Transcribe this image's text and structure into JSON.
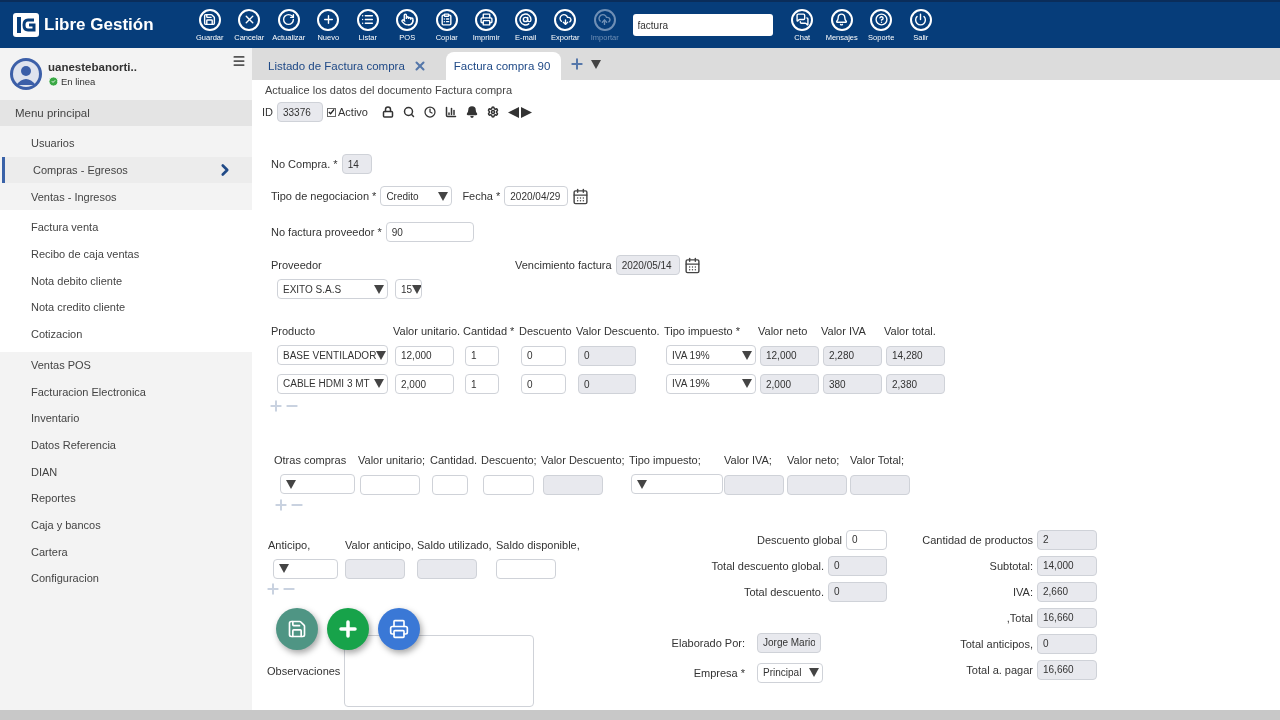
{
  "app": {
    "name": "Libre Gestión"
  },
  "toolbar": [
    {
      "label": "Guardar",
      "kind": "save",
      "disabled": false
    },
    {
      "label": "Cancelar",
      "kind": "cancel",
      "disabled": false
    },
    {
      "label": "Actualizar",
      "kind": "refresh",
      "disabled": false
    },
    {
      "label": "Nuevo",
      "kind": "new",
      "disabled": false
    },
    {
      "label": "Listar",
      "kind": "list",
      "disabled": false
    },
    {
      "label": "POS",
      "kind": "pos",
      "disabled": false
    },
    {
      "label": "Copiar",
      "kind": "copy",
      "disabled": false
    },
    {
      "label": "Imprimir",
      "kind": "print",
      "disabled": false
    },
    {
      "label": "E-mail",
      "kind": "email",
      "disabled": false
    },
    {
      "label": "Exportar",
      "kind": "export",
      "disabled": false
    },
    {
      "label": "Importar",
      "kind": "import",
      "disabled": true
    }
  ],
  "search": {
    "value": "factura"
  },
  "toolbar_right": [
    {
      "label": "Chat",
      "kind": "chat"
    },
    {
      "label": "Mensajes",
      "kind": "bell"
    },
    {
      "label": "Soporte",
      "kind": "help"
    },
    {
      "label": "Salir",
      "kind": "power"
    }
  ],
  "user": {
    "name": "uanestebanorti..",
    "status": "En linea"
  },
  "sidebar": {
    "header": "Menu principal",
    "items": [
      {
        "label": "Usuarios",
        "selected": false
      },
      {
        "label": "Compras - Egresos",
        "selected": true
      },
      {
        "label": "Ventas - Ingresos",
        "selected": false,
        "children": [
          {
            "label": "Factura venta",
            "selected": false
          },
          {
            "label": "Recibo de caja ventas",
            "selected": false
          },
          {
            "label": "Nota debito cliente",
            "selected": false
          },
          {
            "label": "Nota credito cliente",
            "selected": false
          },
          {
            "label": "Cotizacion",
            "selected": false
          }
        ]
      },
      {
        "label": "Ventas POS",
        "selected": false
      },
      {
        "label": "Facturacion Electronica",
        "selected": false
      },
      {
        "label": "Inventario",
        "selected": false
      },
      {
        "label": "Datos Referencia",
        "selected": false
      },
      {
        "label": "DIAN",
        "selected": false
      },
      {
        "label": "Reportes",
        "selected": false
      },
      {
        "label": "Caja y bancos",
        "selected": false
      },
      {
        "label": "Cartera",
        "selected": false
      },
      {
        "label": "Configuracion",
        "selected": false
      }
    ]
  },
  "tabs": [
    {
      "label": "Listado de Factura compra",
      "selected": false,
      "closable": true
    },
    {
      "label": "Factura compra 90",
      "selected": true,
      "closable": false
    }
  ],
  "form": {
    "subtitle": "Actualice los datos del documento Factura compra",
    "id": {
      "label": "ID",
      "value": "33376"
    },
    "active": {
      "label": "Activo",
      "checked": true
    },
    "no_compra": {
      "label": "No Compra. *",
      "value": "14"
    },
    "tipo_negociacion": {
      "label": "Tipo de negociacion *",
      "value": "Credito"
    },
    "fecha": {
      "label": "Fecha *",
      "value": "2020/04/29"
    },
    "no_factura_proveedor": {
      "label": "No factura proveedor *",
      "value": "90"
    },
    "proveedor": {
      "label": "Proveedor",
      "value": "EXITO S.A.S",
      "days": "15"
    },
    "vencimiento": {
      "label": "Vencimiento factura",
      "value": "2020/05/14"
    },
    "products": {
      "columns": [
        {
          "label": "Producto",
          "kind": "select"
        },
        {
          "label": "Valor unitario.",
          "kind": "input"
        },
        {
          "label": "Cantidad *",
          "kind": "input"
        },
        {
          "label": "Descuento",
          "kind": "input"
        },
        {
          "label": "Valor Descuento.",
          "kind": "readonly"
        },
        {
          "label": "Tipo impuesto *",
          "kind": "select"
        },
        {
          "label": "Valor neto",
          "kind": "readonly"
        },
        {
          "label": "Valor IVA",
          "kind": "readonly"
        },
        {
          "label": "Valor total.",
          "kind": "readonly"
        }
      ],
      "rows": [
        [
          "BASE VENTILADOR",
          "12,000",
          "1",
          "0",
          "0",
          "IVA 19%",
          "12,000",
          "2,280",
          "14,280"
        ],
        [
          "CABLE HDMI 3 MT",
          "2,000",
          "1",
          "0",
          "0",
          "IVA 19%",
          "2,000",
          "380",
          "2,380"
        ]
      ]
    },
    "otras_compras": {
      "columns": [
        {
          "label": "Otras compras",
          "kind": "select"
        },
        {
          "label": "Valor unitario;",
          "kind": "input"
        },
        {
          "label": "Cantidad.",
          "kind": "input"
        },
        {
          "label": "Descuento;",
          "kind": "input"
        },
        {
          "label": "Valor Descuento;",
          "kind": "readonly"
        },
        {
          "label": "Tipo impuesto;",
          "kind": "select"
        },
        {
          "label": "Valor IVA;",
          "kind": "readonly"
        },
        {
          "label": "Valor neto;",
          "kind": "readonly"
        },
        {
          "label": "Valor Total;",
          "kind": "readonly"
        }
      ]
    },
    "anticipos": {
      "columns": [
        {
          "label": "Anticipo,",
          "kind": "select"
        },
        {
          "label": "Valor anticipo,",
          "kind": "readonly"
        },
        {
          "label": "Saldo utilizado,",
          "kind": "readonly"
        },
        {
          "label": "Saldo disponible,",
          "kind": "input"
        }
      ]
    },
    "discounts": [
      {
        "label": "Descuento global",
        "value": "0",
        "kind": "input"
      },
      {
        "label": "Total descuento global.",
        "value": "0",
        "kind": "readonly"
      },
      {
        "label": "Total descuento.",
        "value": "0",
        "kind": "readonly"
      }
    ],
    "totals": [
      {
        "label": "Cantidad de productos",
        "value": "2"
      },
      {
        "label": "Subtotal:",
        "value": "14,000"
      },
      {
        "label": "IVA:",
        "value": "2,660"
      },
      {
        "label": ",Total",
        "value": "16,660"
      },
      {
        "label": "Total anticipos,",
        "value": "0"
      },
      {
        "label": "Total a. pagar",
        "value": "16,660"
      }
    ],
    "observaciones": {
      "label": "Observaciones"
    },
    "elaborado_por": {
      "label": "Elaborado Por:",
      "value": "Jorge Mario"
    },
    "empresa": {
      "label": "Empresa *",
      "value": "Principal"
    }
  }
}
